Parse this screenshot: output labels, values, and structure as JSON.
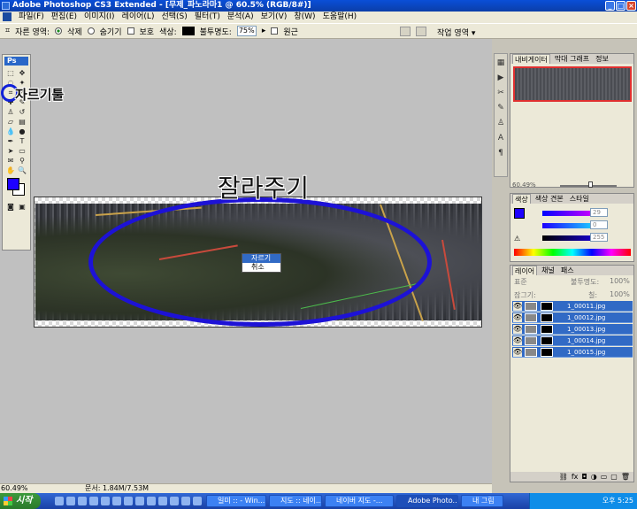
{
  "window": {
    "title": "Adobe Photoshop CS3 Extended - [무제_파노라마1 @ 60.5% (RGB/8#)]"
  },
  "menu": [
    "파일(F)",
    "편집(E)",
    "이미지(I)",
    "레이어(L)",
    "선택(S)",
    "필터(T)",
    "분석(A)",
    "보기(V)",
    "창(W)",
    "도움말(H)"
  ],
  "options": {
    "crop_area_label": "자른 영역:",
    "delete_label": "삭제",
    "hide_label": "숨기기",
    "shield_label": "보호",
    "color_label": "색상:",
    "opacity_label": "불투명도:",
    "opacity_value": "75%",
    "perspective_label": "원근",
    "workspace_label": "작업 영역 ▾"
  },
  "toolbox": {
    "logo": "Ps"
  },
  "annotations": {
    "crop_tool_label": "자르기툴",
    "big_label": "잘라주기"
  },
  "context_menu": {
    "crop": "자르기",
    "cancel": "취소"
  },
  "status": {
    "zoom": "60.49%",
    "doc": "문서: 1.84M/7.53M"
  },
  "panels": {
    "navigator_tabs": [
      "내비게이터",
      "막대 그래프",
      "정보"
    ],
    "navigator_zoom": "60.49%",
    "color_tabs": [
      "색상",
      "색상 견본",
      "스타일"
    ],
    "color_values": [
      "29",
      "0",
      "255"
    ],
    "layers_tabs": [
      "레이어",
      "채널",
      "패스"
    ],
    "blend_mode": "표준",
    "opacity_label": "불투명도:",
    "opacity_value": "100%",
    "lock_label": "잠그기:",
    "fill_label": "칠:",
    "fill_value": "100%",
    "layers": [
      "1_00011.jpg",
      "1_00012.jpg",
      "1_00013.jpg",
      "1_00014.jpg",
      "1_00015.jpg"
    ]
  },
  "taskbar": {
    "start": "시작",
    "tasks": [
      "일미 :: - Win...",
      "지도 :: 네이...",
      "네이버 지도 -...",
      "Adobe Photo...",
      "내 그림"
    ],
    "clock": "오후 5:25"
  },
  "colors": {
    "accent": "#1d12d6",
    "titlebar": "#0a4fd8",
    "selection": "#316ac5"
  }
}
